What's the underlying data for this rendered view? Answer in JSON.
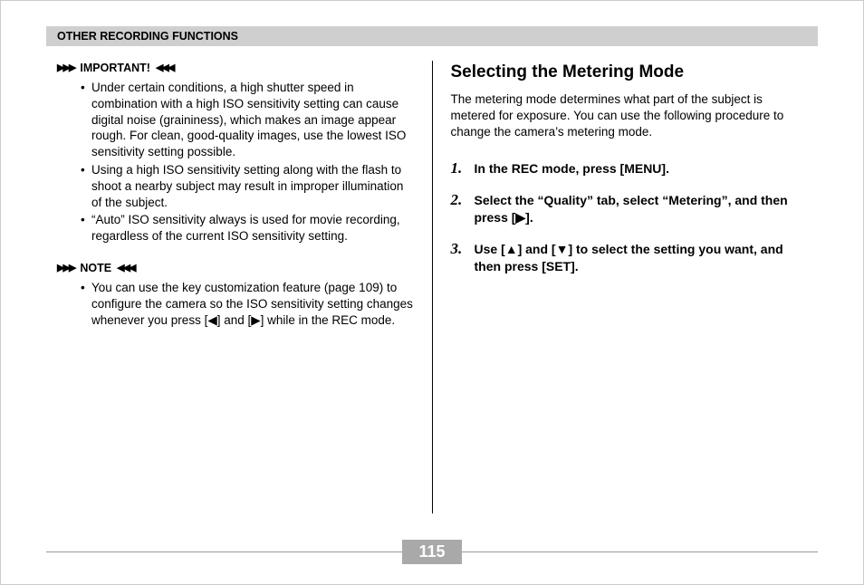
{
  "header": "OTHER RECORDING FUNCTIONS",
  "left": {
    "important_label": "IMPORTANT!",
    "important_bullets": [
      "Under certain conditions, a high shutter speed in combination with a high ISO sensitivity setting can cause digital noise (graininess), which makes an image appear rough. For clean, good-quality images, use the lowest ISO sensitivity setting possible.",
      "Using a high ISO sensitivity setting along with the flash to shoot a nearby subject may result in improper illumination of the subject.",
      "“Auto” ISO sensitivity always is used for movie recording, regardless of the current ISO sensitivity setting."
    ],
    "note_label": "NOTE",
    "note_bullets": [
      "You can use the key customization feature (page 109) to configure the camera so the ISO sensitivity setting changes whenever you press [◀] and [▶] while in the REC mode."
    ]
  },
  "right": {
    "title": "Selecting the Metering Mode",
    "intro": "The metering mode determines what part of the subject is metered for exposure. You can use the following procedure to change the camera’s metering mode.",
    "steps": [
      "In the REC mode, press [MENU].",
      "Select the “Quality” tab, select “Metering”, and then press [▶].",
      "Use [▲] and [▼] to select the setting you want, and then press [SET]."
    ]
  },
  "page_number": "115"
}
